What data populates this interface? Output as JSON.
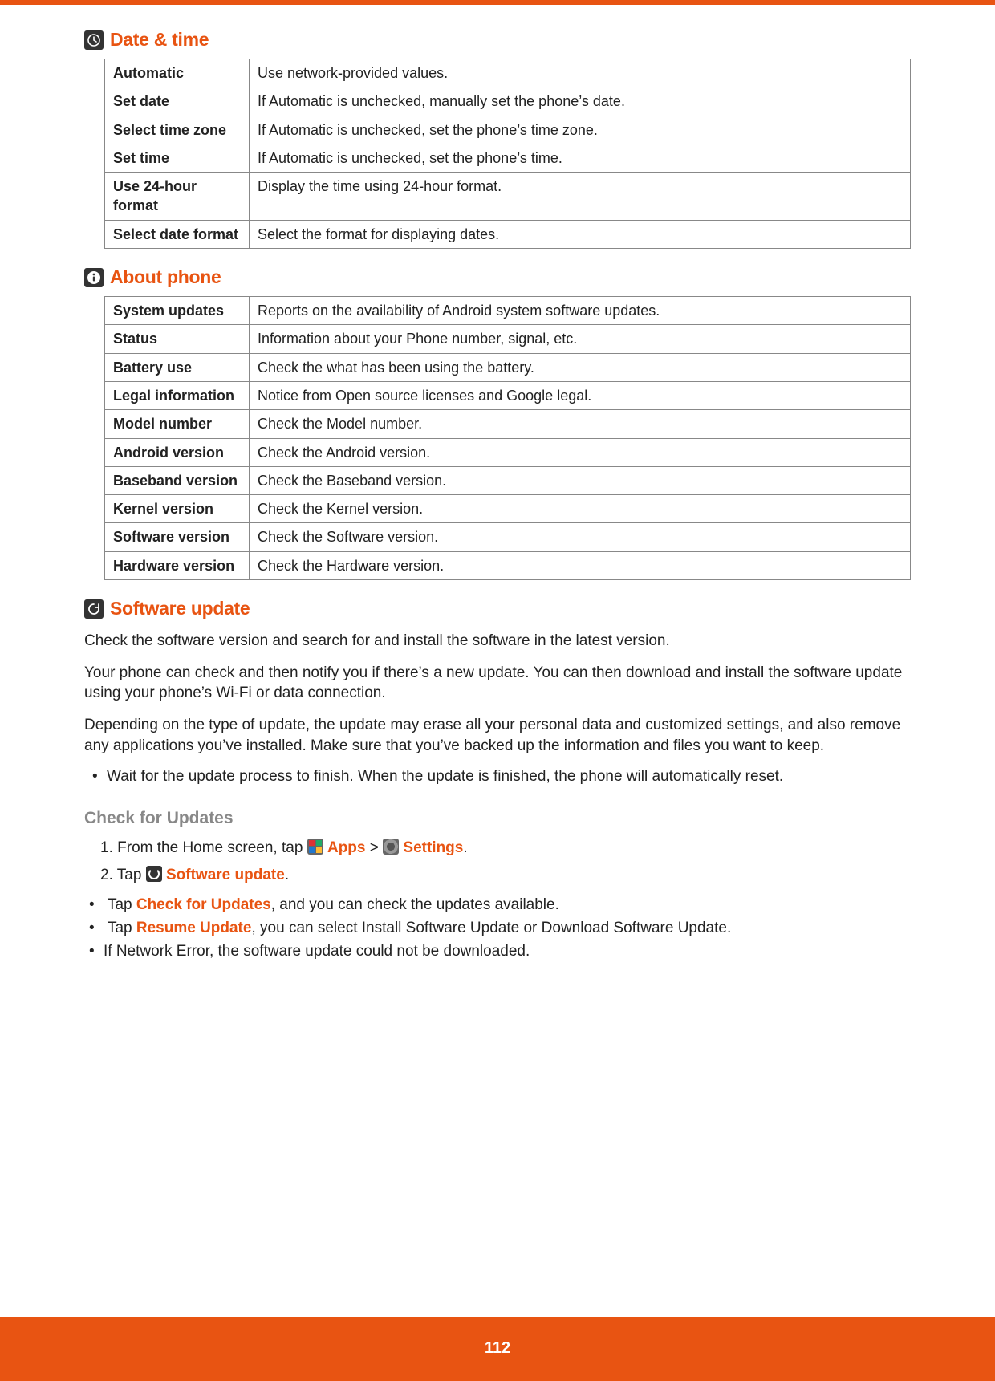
{
  "headings": {
    "date_time": "Date & time",
    "about_phone": "About phone",
    "software_update": "Software update"
  },
  "tables": {
    "date_time": [
      {
        "k": "Automatic",
        "v": "Use network-provided values."
      },
      {
        "k": "Set date",
        "v": "If Automatic is unchecked, manually set the phone’s date."
      },
      {
        "k": "Select time zone",
        "v": "If Automatic is unchecked, set the phone’s time zone."
      },
      {
        "k": "Set time",
        "v": "If Automatic is unchecked, set the phone’s time."
      },
      {
        "k": "Use 24-hour format",
        "v": "Display the time using 24-hour format."
      },
      {
        "k": "Select date format",
        "v": "Select the format for displaying dates."
      }
    ],
    "about_phone": [
      {
        "k": "System updates",
        "v": "Reports on the availability of Android system software updates."
      },
      {
        "k": "Status",
        "v": "Information about your Phone number, signal, etc."
      },
      {
        "k": "Battery use",
        "v": "Check the what has been using the battery."
      },
      {
        "k": "Legal information",
        "v": "Notice from Open source licenses and Google legal."
      },
      {
        "k": "Model number",
        "v": "Check the Model number."
      },
      {
        "k": "Android version",
        "v": "Check the Android version."
      },
      {
        "k": "Baseband version",
        "v": "Check the Baseband version."
      },
      {
        "k": "Kernel version",
        "v": "Check the Kernel version."
      },
      {
        "k": "Software version",
        "v": "Check the Software version."
      },
      {
        "k": "Hardware version",
        "v": "Check the Hardware version."
      }
    ]
  },
  "software_update_paras": [
    "Check the software version and search for and install the software in the latest version.",
    "Your phone can check and then notify you if there’s a new update. You can then download and install the software update using your phone’s Wi-Fi or data connection.",
    "Depending on the type of update, the update may erase all your personal data and customized settings, and also remove any applications you’ve installed. Make sure that you’ve backed up the information and files you want to keep."
  ],
  "software_update_bullets": [
    "Wait for the update process to finish. When the update is finished, the phone will automatically reset."
  ],
  "check_updates": {
    "heading": "Check for Updates",
    "step1": {
      "num": "1.",
      "pre": "From the Home screen, tap ",
      "apps": "Apps",
      "gt": " > ",
      "settings": "Settings",
      "post": "."
    },
    "step2": {
      "num": "2.",
      "pre": "Tap ",
      "label": "Software update",
      "post": "."
    },
    "sub": {
      "a_pre": "Tap ",
      "a_em": "Check for Updates",
      "a_post": ", and you can check the updates available.",
      "b_pre": "Tap ",
      "b_em": "Resume Update",
      "b_post": ", you can select Install Software Update or Download Software Update.",
      "c": "If Network Error, the software update could not be downloaded."
    }
  },
  "page_number": "112"
}
